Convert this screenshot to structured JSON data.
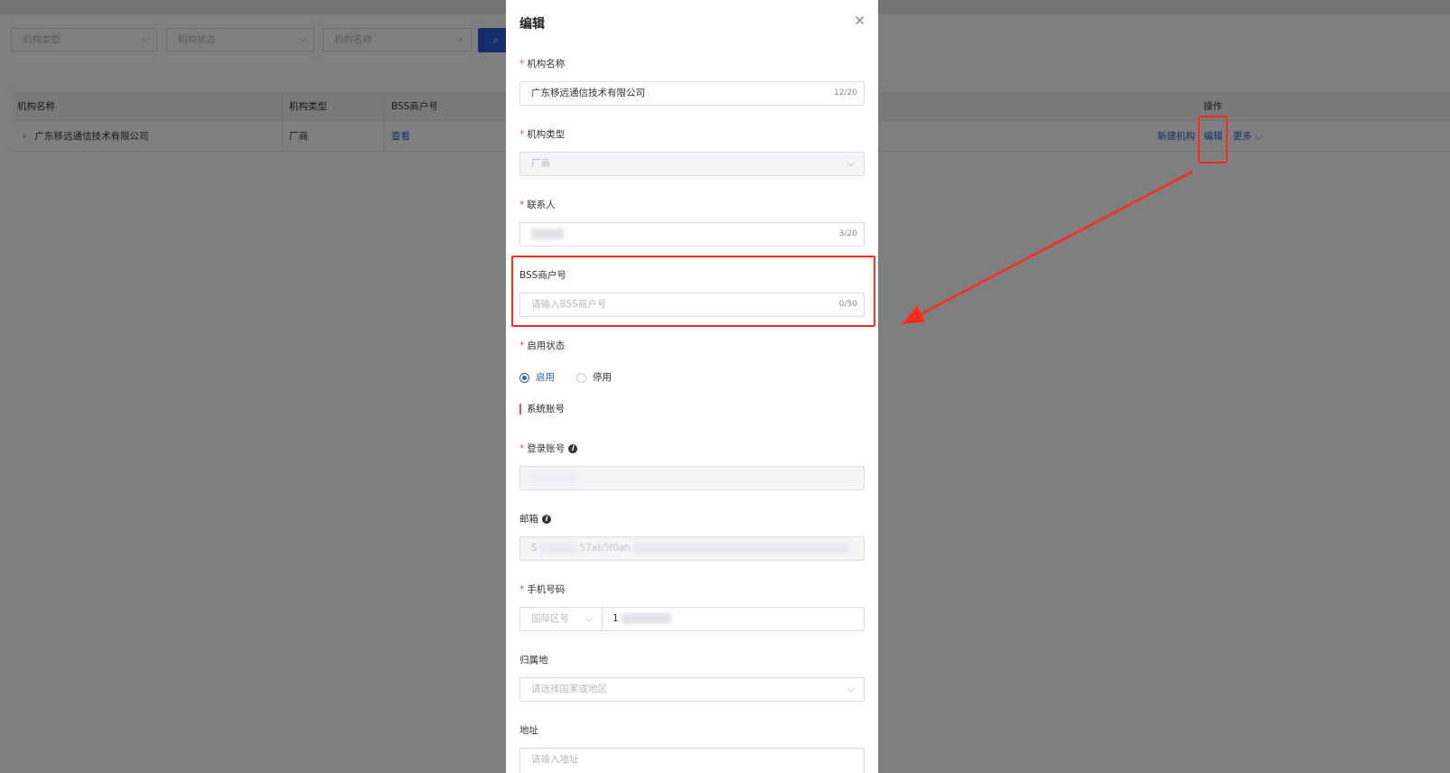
{
  "background": {
    "filters": [
      {
        "placeholder": "机构类型"
      },
      {
        "placeholder": "机构状态"
      },
      {
        "placeholder": "机构名称"
      }
    ],
    "table": {
      "headers": [
        "机构名称",
        "机构类型",
        "BSS商户号",
        "操作"
      ],
      "row": {
        "name": "广东移远通信技术有限公司",
        "type": "厂商",
        "bss": "查看",
        "actions": [
          "新建机构",
          "编辑",
          "更多"
        ]
      }
    }
  },
  "modal": {
    "title": "编辑",
    "fields": {
      "org_name": {
        "label": "机构名称",
        "value": "广东移远通信技术有限公司",
        "counter": "12/20"
      },
      "org_type": {
        "label": "机构类型",
        "value": "厂商"
      },
      "contact": {
        "label": "联系人",
        "counter": "3/20"
      },
      "bss": {
        "label": "BSS商户号",
        "placeholder": "请输入BSS商户号",
        "counter": "0/50"
      },
      "status": {
        "label": "启用状态",
        "options": [
          "启用",
          "停用"
        ],
        "selected": "启用"
      },
      "section": "系统账号",
      "login": {
        "label": "登录账号"
      },
      "email": {
        "label": "邮箱",
        "value_prefix": "S",
        "value_visible": "57ab5f0ah"
      },
      "phone": {
        "label": "手机号码",
        "code_placeholder": "国际区号",
        "value_prefix": "1"
      },
      "region": {
        "label": "归属地",
        "placeholder": "请选择国家或地区"
      },
      "address": {
        "label": "地址",
        "placeholder": "请输入地址"
      }
    }
  },
  "colors": {
    "primary": "#2a5bd7",
    "annotation": "#ff2a1e",
    "required": "#e34d4d"
  }
}
